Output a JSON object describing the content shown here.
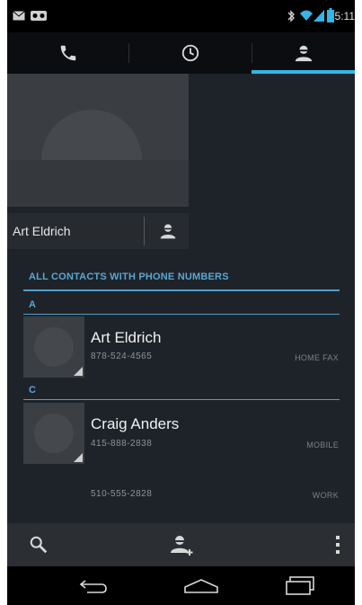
{
  "status_bar": {
    "time": "5:11",
    "icons": [
      "email-icon",
      "voicemail-icon",
      "bluetooth-icon",
      "wifi-icon",
      "signal-icon",
      "battery-icon"
    ]
  },
  "tabs": [
    {
      "name": "phone-icon",
      "selected": false
    },
    {
      "name": "clock-icon",
      "selected": false
    },
    {
      "name": "contact-icon",
      "selected": true
    }
  ],
  "detail": {
    "name": "Art Eldrich"
  },
  "contacts": {
    "section_header": "ALL CONTACTS WITH PHONE NUMBERS",
    "groups": [
      {
        "letter": "A",
        "items": [
          {
            "name": "Art Eldrich",
            "phones": [
              {
                "number": "878-524-4565",
                "type": "HOME FAX"
              }
            ]
          }
        ]
      },
      {
        "letter": "C",
        "items": [
          {
            "name": "Craig Anders",
            "phones": [
              {
                "number": "415-888-2838",
                "type": "MOBILE"
              },
              {
                "number": "510-555-2828",
                "type": "WORK"
              }
            ]
          }
        ]
      }
    ]
  },
  "action_bar": {
    "icons": [
      "search-icon",
      "add-contact-icon",
      "overflow-menu-icon"
    ]
  },
  "nav_bar": {
    "icons": [
      "back-icon",
      "home-icon",
      "recents-icon"
    ]
  },
  "colors": {
    "accent": "#33b5e5",
    "background": "#1e2329",
    "header_text": "#5aa6d2"
  }
}
